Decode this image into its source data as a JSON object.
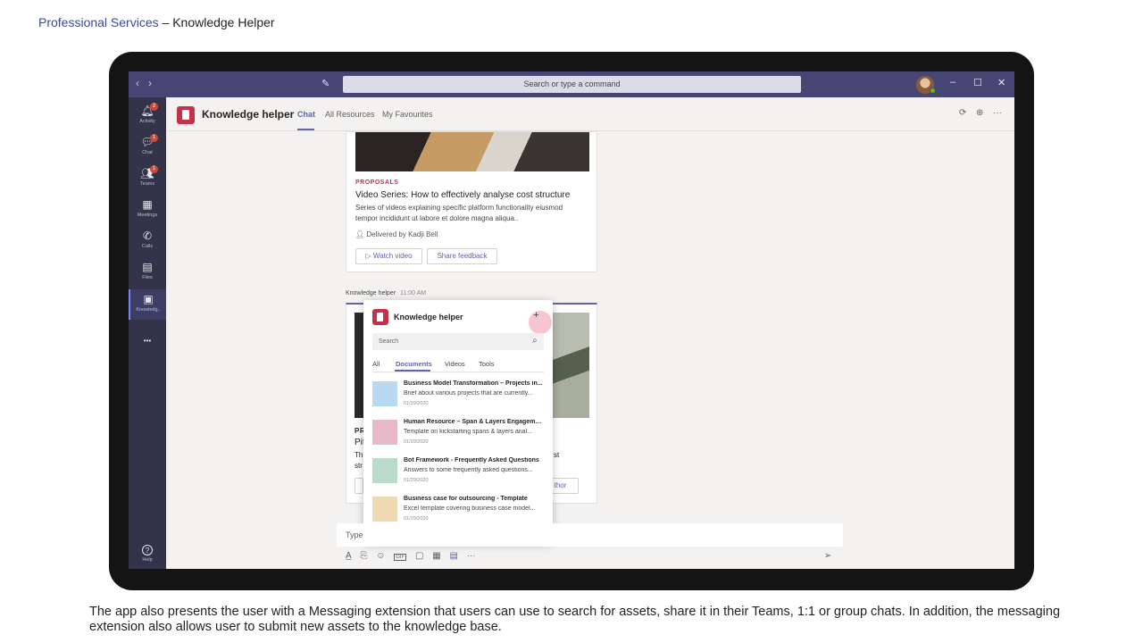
{
  "slide": {
    "brand": "Professional Services",
    "title_rest": " – Knowledge  Helper",
    "caption": "The app also presents the user with a Messaging extension that users can use to search for assets, share it in their Teams, 1:1 or group chats. In addition, the messaging extension also allows user to submit new assets to the knowledge base."
  },
  "titlebar": {
    "search_placeholder": "Search or type a command",
    "nav_back": "‹",
    "nav_forward": "›",
    "minimize": "–",
    "maximize": "☐",
    "close": "✕"
  },
  "rail": {
    "items": [
      {
        "label": "Activity",
        "icon": "bell-icon",
        "glyph": "🔔︎",
        "badge": "2"
      },
      {
        "label": "Chat",
        "icon": "chat-icon",
        "glyph": "💬︎",
        "badge": "1"
      },
      {
        "label": "Teams",
        "icon": "teams-icon",
        "glyph": "👥︎",
        "badge": "1"
      },
      {
        "label": "Meetings",
        "icon": "calendar-icon",
        "glyph": "▦",
        "badge": ""
      },
      {
        "label": "Calls",
        "icon": "phone-icon",
        "glyph": "✆",
        "badge": ""
      },
      {
        "label": "Files",
        "icon": "file-icon",
        "glyph": "▤",
        "badge": ""
      },
      {
        "label": "Knowledg..",
        "icon": "knowledge-icon",
        "glyph": "▣",
        "badge": ""
      }
    ],
    "more": "•••",
    "help_label": "Help",
    "help_glyph": "?"
  },
  "header": {
    "app_title": "Knowledge helper",
    "tabs": [
      "Chat",
      "All Resources",
      "My Favourites"
    ],
    "active_tab": "Chat",
    "refresh_glyph": "⟳",
    "globe_glyph": "⊕",
    "more_glyph": "···"
  },
  "card1": {
    "kicker": "PROPOSALS",
    "title": "Video Series: How to effectively analyse cost structure",
    "desc_line1": "Series of videos explaining specific platform functionality eiusmod",
    "desc_line2": "tempor incididunt ut labore et dolore magna aliqua..",
    "delivered": "Delivered by Kadji Bell",
    "watch_button": "▷ Watch video",
    "feedback_button": "Share feedback"
  },
  "message": {
    "sender": "Knowledge helper",
    "time": "11:00 AM"
  },
  "card2": {
    "kicker_frag": "PR",
    "title_frag": "Pit",
    "desc_frag1": "Th",
    "desc_frag2": "str",
    "desc_right": "st",
    "button_right": "thor"
  },
  "popup": {
    "title": "Knowledge helper",
    "plus": "+",
    "search_placeholder": "Search",
    "tabs": [
      "All",
      "Documents",
      "Videos",
      "Tools"
    ],
    "active_tab": "Documents",
    "documents": [
      {
        "title": "Business Model Transformation – Projects in...",
        "desc": "Brief about various projects that are currently...",
        "date": "01/29/2020",
        "color": "#b9d9f0"
      },
      {
        "title": "Human Resource – Span & Layers Engageme...",
        "desc": "Template on kickstarting spans & layers anal...",
        "date": "01/29/2020",
        "color": "#e8b9c8"
      },
      {
        "title": "Bot Framework - Frequently Asked Questions",
        "desc": "Answers to some frequently asked questions...",
        "date": "01/29/2020",
        "color": "#b7dcc7"
      },
      {
        "title": "Business case for outsourcing - Template",
        "desc": "Excel template covering business case model...",
        "date": "01/29/2020",
        "color": "#eed9b0"
      }
    ]
  },
  "compose": {
    "placeholder": "Type",
    "tools": [
      "A̲",
      "⎘",
      "☺",
      "GIF",
      "▢",
      "▦",
      "▤",
      "···"
    ],
    "send_glyph": "➢"
  }
}
